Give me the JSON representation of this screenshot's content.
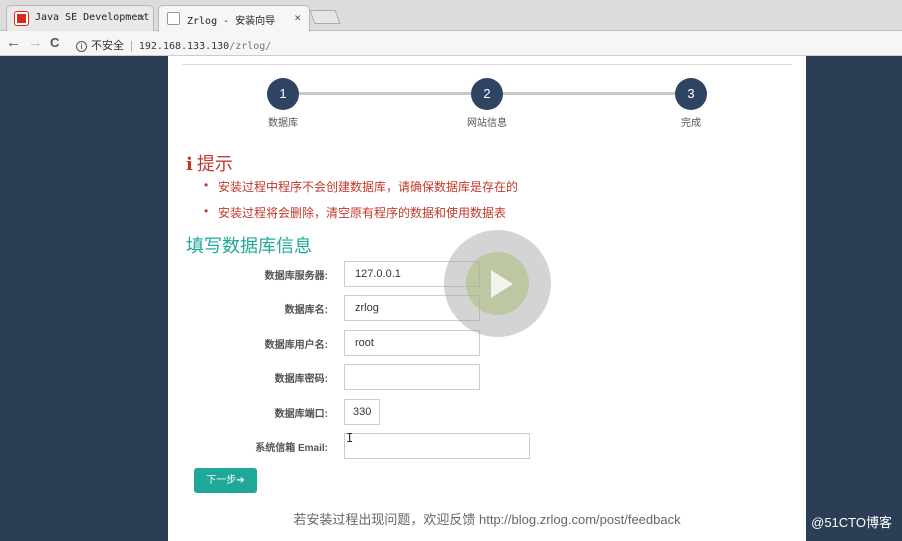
{
  "browser": {
    "tabs": [
      {
        "title": "Java SE Development K",
        "close": "×"
      },
      {
        "title": "Zrlog - 安装向导",
        "close": "×"
      }
    ],
    "nav": {
      "back": "←",
      "forward": "→",
      "reload": "C"
    },
    "address": {
      "security": "不安全",
      "host": "192.168.133.130",
      "path": "/zrlog/"
    }
  },
  "steps": [
    {
      "number": "1",
      "label": "数据库"
    },
    {
      "number": "2",
      "label": "网站信息"
    },
    {
      "number": "3",
      "label": "完成"
    }
  ],
  "tips": {
    "title": "提示",
    "items": [
      "安装过程中程序不会创建数据库，请确保数据库是存在的",
      "安装过程将会删除，清空原有程序的数据和使用数据表"
    ]
  },
  "form": {
    "title": "填写数据库信息",
    "fields": [
      {
        "label": "数据库服务器:",
        "value": ""
      },
      {
        "label": "数据库名:",
        "value": "zrlog"
      },
      {
        "label": "数据库用户名:",
        "value": "root"
      },
      {
        "label": "数据库密码:",
        "value": ""
      },
      {
        "label": "数据库端口:",
        "value": "330"
      },
      {
        "label": "系统信箱 Email:",
        "value": ""
      }
    ],
    "server_value": "127.0.0.1",
    "next_label": "下一步➔"
  },
  "footer": "若安装过程出现问题，欢迎反馈 http://blog.zrlog.com/post/feedback",
  "watermark": "@51CTO博客",
  "colors": {
    "accent": "#1fa899",
    "step": "#2e4462",
    "tip": "#c0392b",
    "side": "#2c3e55"
  }
}
